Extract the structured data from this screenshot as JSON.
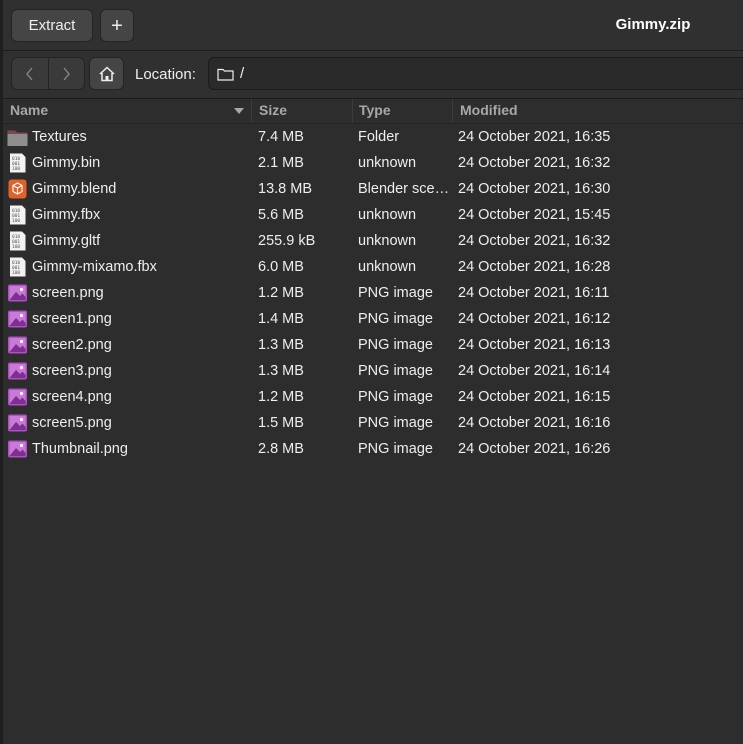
{
  "header": {
    "extract_label": "Extract",
    "add_label": "+",
    "title": "Gimmy.zip"
  },
  "location": {
    "label": "Location:",
    "path": "/"
  },
  "columns": {
    "name": "Name",
    "size": "Size",
    "type": "Type",
    "modified": "Modified"
  },
  "files": [
    {
      "icon": "folder-icon",
      "name": "Textures",
      "size": "7.4 MB",
      "type": "Folder",
      "modified": "24 October 2021, 16:35"
    },
    {
      "icon": "binary-file-icon",
      "name": "Gimmy.bin",
      "size": "2.1 MB",
      "type": "unknown",
      "modified": "24 October 2021, 16:32"
    },
    {
      "icon": "blender-file-icon",
      "name": "Gimmy.blend",
      "size": "13.8 MB",
      "type": "Blender sce…",
      "modified": "24 October 2021, 16:30"
    },
    {
      "icon": "binary-file-icon",
      "name": "Gimmy.fbx",
      "size": "5.6 MB",
      "type": "unknown",
      "modified": "24 October 2021, 15:45"
    },
    {
      "icon": "binary-file-icon",
      "name": "Gimmy.gltf",
      "size": "255.9 kB",
      "type": "unknown",
      "modified": "24 October 2021, 16:32"
    },
    {
      "icon": "binary-file-icon",
      "name": "Gimmy-mixamo.fbx",
      "size": "6.0 MB",
      "type": "unknown",
      "modified": "24 October 2021, 16:28"
    },
    {
      "icon": "image-file-icon",
      "name": "screen.png",
      "size": "1.2 MB",
      "type": "PNG image",
      "modified": "24 October 2021, 16:11"
    },
    {
      "icon": "image-file-icon",
      "name": "screen1.png",
      "size": "1.4 MB",
      "type": "PNG image",
      "modified": "24 October 2021, 16:12"
    },
    {
      "icon": "image-file-icon",
      "name": "screen2.png",
      "size": "1.3 MB",
      "type": "PNG image",
      "modified": "24 October 2021, 16:13"
    },
    {
      "icon": "image-file-icon",
      "name": "screen3.png",
      "size": "1.3 MB",
      "type": "PNG image",
      "modified": "24 October 2021, 16:14"
    },
    {
      "icon": "image-file-icon",
      "name": "screen4.png",
      "size": "1.2 MB",
      "type": "PNG image",
      "modified": "24 October 2021, 16:15"
    },
    {
      "icon": "image-file-icon",
      "name": "screen5.png",
      "size": "1.5 MB",
      "type": "PNG image",
      "modified": "24 October 2021, 16:16"
    },
    {
      "icon": "image-file-icon",
      "name": "Thumbnail.png",
      "size": "2.8 MB",
      "type": "PNG image",
      "modified": "24 October 2021, 16:26"
    }
  ],
  "colors": {
    "background": "#2d2d2d",
    "headerbar": "#303030",
    "button": "#454545",
    "text": "#eeeeee",
    "header_text": "#a8a8a8",
    "image_icon": "#b04fc4",
    "blender_icon": "#e0622a"
  }
}
